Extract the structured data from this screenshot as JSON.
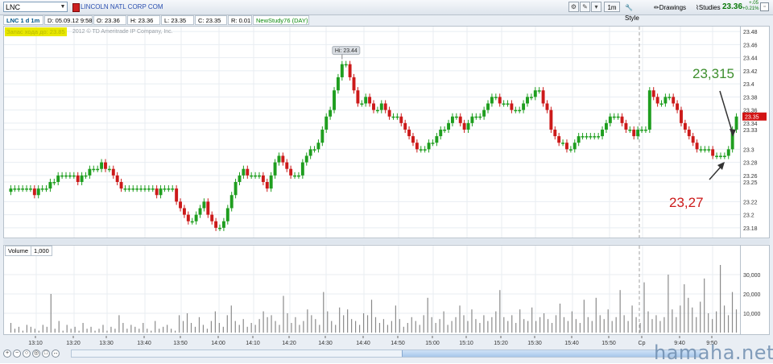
{
  "toolbar": {
    "symbol": "LNC",
    "company_name": "LINCOLN NATL CORP COM",
    "interval": "1m",
    "style_label": "Style",
    "drawings_label": "Drawings",
    "studies_label": "Studies",
    "last_price": "23.36",
    "net_change": "+.05",
    "net_change_pct": "+0.21%"
  },
  "info": {
    "title": "LNC 1 d 1m",
    "date": "D: 05.09.12 9:58",
    "open": "O: 23.36",
    "high": "H: 23.36",
    "low": "L: 23.35",
    "close": "C: 23.35",
    "range": "R: 0.01",
    "study": "NewStudy76 (DAY)"
  },
  "banner": {
    "ad_text": "Запас хода до: 23.85",
    "copyright": "2012 © TD Ameritrade IP Company, Inc."
  },
  "annotations": {
    "hi_label": "Hi: 23.44",
    "current_price_tag": "23.35",
    "upper_target": "23,315",
    "lower_target": "23,27",
    "session_marker": "Ср"
  },
  "volume": {
    "label": "Volume",
    "value": "1,000"
  },
  "watermark": "hamaha.net",
  "colors": {
    "up": "#1f9e1f",
    "down": "#cc1a1a",
    "annotation_green": "#3e8f2e",
    "annotation_red": "#cc1a1a",
    "volume_bar": "#8a8a8a"
  },
  "icons": [
    "dropdown-arrow-icon",
    "company-color-icon",
    "pencil-icon",
    "settings-icon",
    "zoom-in-icon",
    "zoom-out-icon",
    "window-icon"
  ],
  "chart_data": [
    {
      "type": "candlestick",
      "price_ticks": [
        "23.48",
        "23.46",
        "23.44",
        "23.42",
        "23.4",
        "23.38",
        "23.36",
        "23.34",
        "23.33",
        "23.3",
        "23.28",
        "23.26",
        "23.25",
        "23.22",
        "23.2",
        "23.18"
      ],
      "ylim": [
        23.17,
        23.485
      ],
      "time_ticks": [
        "13:10",
        "13:20",
        "13:30",
        "13:40",
        "13:50",
        "14:00",
        "14:10",
        "14:20",
        "14:30",
        "14:40",
        "14:50",
        "15:00",
        "15:10",
        "15:20",
        "15:30",
        "15:40",
        "15:50",
        "Ср",
        "9:40",
        "9:50"
      ],
      "close": [
        23.24,
        23.24,
        23.24,
        23.24,
        23.24,
        23.24,
        23.23,
        23.24,
        23.24,
        23.24,
        23.25,
        23.25,
        23.26,
        23.26,
        23.26,
        23.26,
        23.26,
        23.25,
        23.26,
        23.26,
        23.27,
        23.27,
        23.27,
        23.28,
        23.27,
        23.27,
        23.26,
        23.25,
        23.24,
        23.24,
        23.24,
        23.24,
        23.24,
        23.24,
        23.24,
        23.24,
        23.24,
        23.23,
        23.24,
        23.24,
        23.24,
        23.24,
        23.22,
        23.21,
        23.2,
        23.19,
        23.19,
        23.2,
        23.21,
        23.22,
        23.2,
        23.19,
        23.18,
        23.18,
        23.19,
        23.21,
        23.23,
        23.25,
        23.26,
        23.27,
        23.26,
        23.26,
        23.26,
        23.26,
        23.25,
        23.24,
        23.26,
        23.28,
        23.29,
        23.28,
        23.27,
        23.26,
        23.26,
        23.26,
        23.28,
        23.29,
        23.3,
        23.3,
        23.31,
        23.33,
        23.35,
        23.36,
        23.39,
        23.41,
        23.43,
        23.43,
        23.41,
        23.39,
        23.37,
        23.37,
        23.38,
        23.37,
        23.36,
        23.36,
        23.37,
        23.36,
        23.35,
        23.35,
        23.35,
        23.34,
        23.33,
        23.32,
        23.31,
        23.3,
        23.3,
        23.3,
        23.31,
        23.31,
        23.32,
        23.33,
        23.33,
        23.34,
        23.35,
        23.35,
        23.34,
        23.33,
        23.34,
        23.35,
        23.35,
        23.35,
        23.36,
        23.37,
        23.38,
        23.38,
        23.37,
        23.37,
        23.37,
        23.36,
        23.36,
        23.36,
        23.37,
        23.38,
        23.38,
        23.39,
        23.39,
        23.37,
        23.36,
        23.33,
        23.32,
        23.31,
        23.31,
        23.3,
        23.3,
        23.31,
        23.32,
        23.32,
        23.32,
        23.32,
        23.32,
        23.32,
        23.33,
        23.34,
        23.35,
        23.35,
        23.35,
        23.34,
        23.33,
        23.33,
        23.32,
        23.33,
        23.33,
        23.33,
        23.39,
        23.38,
        23.37,
        23.37,
        23.38,
        23.38,
        23.37,
        23.36,
        23.34,
        23.33,
        23.32,
        23.31,
        23.3,
        23.3,
        23.3,
        23.3,
        23.29,
        23.29,
        23.29,
        23.29,
        23.3,
        23.33,
        23.35
      ],
      "hi": 23.44,
      "ylabel": "",
      "xlabel": ""
    },
    {
      "type": "bar",
      "series_name": "Volume",
      "ylim": [
        0,
        40000
      ],
      "y_ticks": [
        "30,000",
        "20,000",
        "10,000"
      ],
      "values": [
        5000,
        2000,
        3000,
        1000,
        4000,
        3000,
        2000,
        1000,
        4000,
        3000,
        20000,
        2000,
        6000,
        1000,
        4000,
        2000,
        3000,
        1000,
        5000,
        2000,
        3000,
        1000,
        2000,
        4000,
        1000,
        3000,
        2000,
        9000,
        5000,
        2000,
        4000,
        3000,
        2000,
        5000,
        2000,
        1000,
        6000,
        2000,
        3000,
        4000,
        2000,
        1000,
        9000,
        6000,
        10000,
        5000,
        3000,
        8000,
        4000,
        2000,
        6000,
        11000,
        5000,
        3000,
        9000,
        14000,
        6000,
        4000,
        7000,
        3000,
        5000,
        4000,
        7000,
        11000,
        8000,
        9000,
        6000,
        4000,
        19000,
        10000,
        5000,
        8000,
        4000,
        6000,
        12000,
        9000,
        7000,
        4000,
        21000,
        11000,
        6000,
        4000,
        13000,
        9000,
        12000,
        7000,
        6000,
        4000,
        10000,
        9000,
        17000,
        8000,
        5000,
        7000,
        4000,
        6000,
        14000,
        7000,
        3000,
        5000,
        8000,
        6000,
        4000,
        9000,
        18000,
        8000,
        5000,
        7000,
        11000,
        4000,
        6000,
        8000,
        14000,
        9000,
        6000,
        12000,
        7000,
        5000,
        9000,
        6000,
        8000,
        11000,
        22000,
        8000,
        6000,
        9000,
        5000,
        12000,
        7000,
        6000,
        13000,
        6000,
        8000,
        10000,
        7000,
        5000,
        9000,
        15000,
        8000,
        6000,
        11000,
        7000,
        5000,
        17000,
        8000,
        6000,
        18000,
        9000,
        7000,
        12000,
        6000,
        8000,
        22000,
        9000,
        6000,
        14000,
        8000,
        5000,
        26000,
        11000,
        7000,
        9000,
        6000,
        8000,
        30000,
        12000,
        8000,
        14000,
        25000,
        18000,
        13000,
        8000,
        16000,
        28000,
        10000,
        7000,
        11000,
        35000,
        14000,
        9000,
        21000,
        12000
      ]
    }
  ]
}
